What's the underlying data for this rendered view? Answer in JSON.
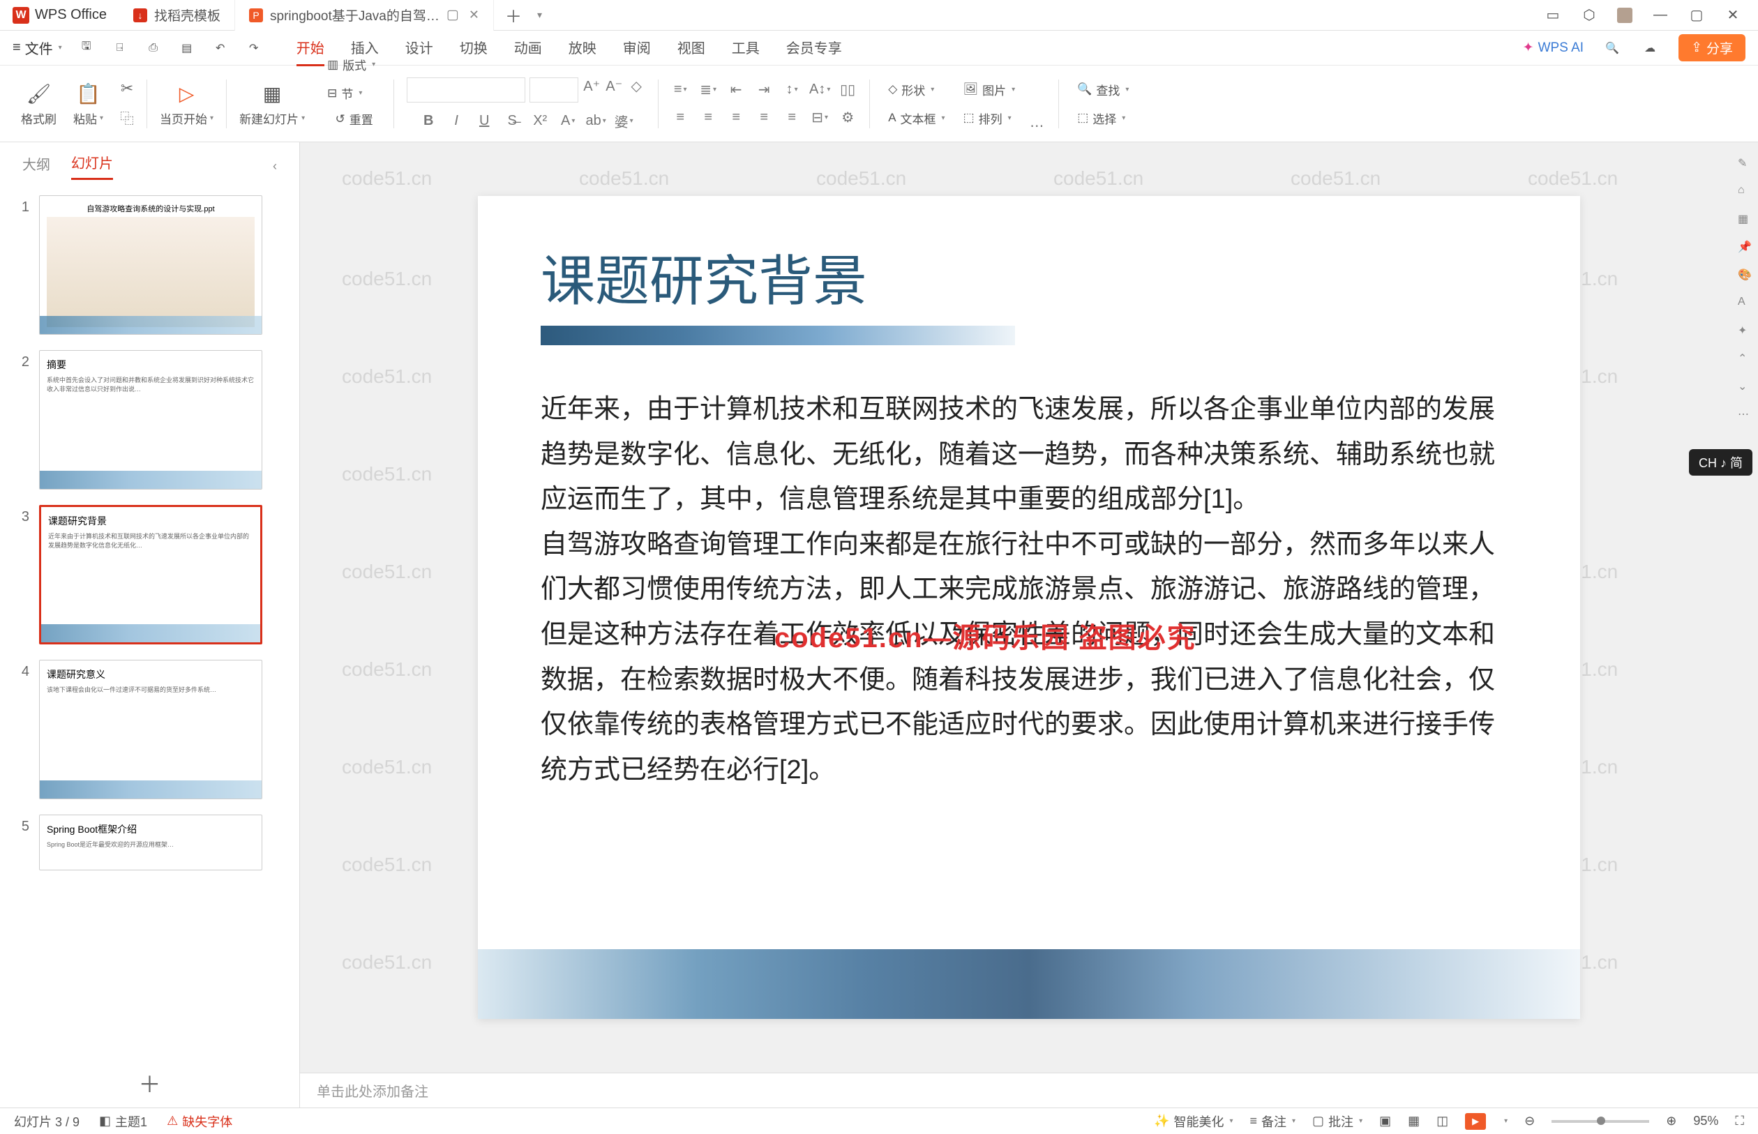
{
  "app": {
    "name": "WPS Office"
  },
  "tabs": [
    {
      "icon": "↓",
      "label": "找稻壳模板",
      "active": false
    },
    {
      "icon": "P",
      "label": "springboot基于Java的自驾…",
      "active": true
    }
  ],
  "menu": {
    "file": "文件",
    "items": [
      "开始",
      "插入",
      "设计",
      "切换",
      "动画",
      "放映",
      "审阅",
      "视图",
      "工具",
      "会员专享"
    ],
    "active": "开始",
    "wps_ai": "WPS AI",
    "share": "分享"
  },
  "ribbon": {
    "format_painter": "格式刷",
    "paste": "粘贴",
    "from_current": "当页开始",
    "new_slide": "新建幻灯片",
    "layout": "版式",
    "section": "节",
    "reset": "重置",
    "font_name": "",
    "font_size": "",
    "shape": "形状",
    "image": "图片",
    "textbox": "文本框",
    "arrange": "排列",
    "find": "查找",
    "select": "选择"
  },
  "sidebar": {
    "tab_outline": "大纲",
    "tab_slides": "幻灯片",
    "thumbs": [
      {
        "n": "1",
        "title": "自驾游攻略查询系统的设计与实现.ppt"
      },
      {
        "n": "2",
        "title": "摘要"
      },
      {
        "n": "3",
        "title": "课题研究背景"
      },
      {
        "n": "4",
        "title": "课题研究意义"
      },
      {
        "n": "5",
        "title": "Spring Boot框架介绍"
      }
    ]
  },
  "slide": {
    "title": "课题研究背景",
    "para1": "近年来，由于计算机技术和互联网技术的飞速发展，所以各企事业单位内部的发展趋势是数字化、信息化、无纸化，随着这一趋势，而各种决策系统、辅助系统也就应运而生了，其中，信息管理系统是其中重要的组成部分[1]。",
    "para2": "自驾游攻略查询管理工作向来都是在旅行社中不可或缺的一部分，然而多年以来人们大都习惯使用传统方法，即人工来完成旅游景点、旅游游记、旅游路线的管理，但是这种方法存在着工作效率低以及保密性差的问题，同时还会生成大量的文本和数据，在检索数据时极大不便。随着科技发展进步，我们已进入了信息化社会，仅仅依靠传统的表格管理方式已不能适应时代的要求。因此使用计算机来进行接手传统方式已经势在必行[2]。",
    "watermark_center": "code51.cn—源码乐园 盗图必究"
  },
  "notes_placeholder": "单击此处添加备注",
  "status": {
    "slide_counter": "幻灯片 3 / 9",
    "theme": "主题1",
    "missing_font": "缺失字体",
    "beautify": "智能美化",
    "notes": "备注",
    "review": "批注",
    "zoom": "95%",
    "ime": "CH ♪ 简"
  },
  "watermark": "code51.cn"
}
